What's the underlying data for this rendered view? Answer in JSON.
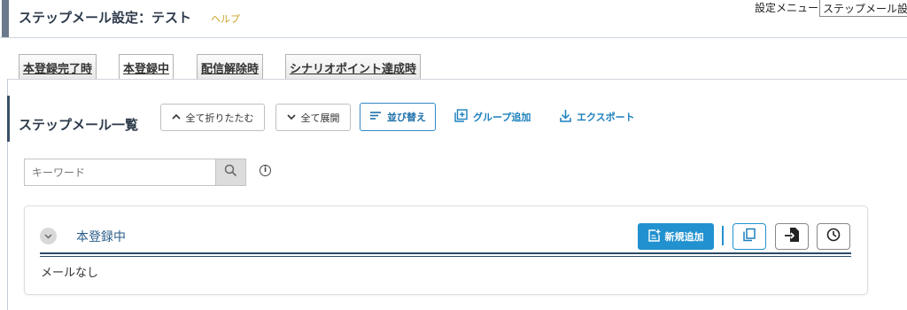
{
  "header": {
    "title": "ステップメール設定：テスト",
    "help_label": "ヘルプ",
    "settings_menu_label": "設定メニュー",
    "settings_menu_value": "ステップメール設定"
  },
  "tabs": [
    {
      "label": "本登録完了時",
      "active": false
    },
    {
      "label": "本登録中",
      "active": true
    },
    {
      "label": "配信解除時",
      "active": false
    },
    {
      "label": "シナリオポイント達成時",
      "active": false
    }
  ],
  "panel": {
    "title": "ステップメール一覧",
    "toolbar": {
      "collapse_all_label": "全て折りたたむ",
      "expand_all_label": "全て展開",
      "sort_label": "並び替え",
      "add_group_label": "グループ追加",
      "export_label": "エクスポート"
    },
    "search": {
      "placeholder": "キーワード"
    }
  },
  "group": {
    "title": "本登録中",
    "add_new_label": "新規追加",
    "empty_text": "メールなし"
  },
  "colors": {
    "accent_blue": "#2291cf",
    "link_blue": "#1b7fbd",
    "help_gold": "#c9a227",
    "rule_navy": "#2d4a67"
  },
  "icons": {
    "collapse_all": "chevron-up-icon",
    "expand_all": "chevron-down-icon",
    "sort": "sort-lines-icon",
    "add_group": "plus-square-icon",
    "export": "download-icon",
    "search": "search-icon",
    "info": "info-icon",
    "group_toggle": "chevron-down-icon",
    "add_new": "add-document-icon",
    "copy": "copy-icon",
    "import": "import-icon",
    "schedule": "clock-icon"
  }
}
